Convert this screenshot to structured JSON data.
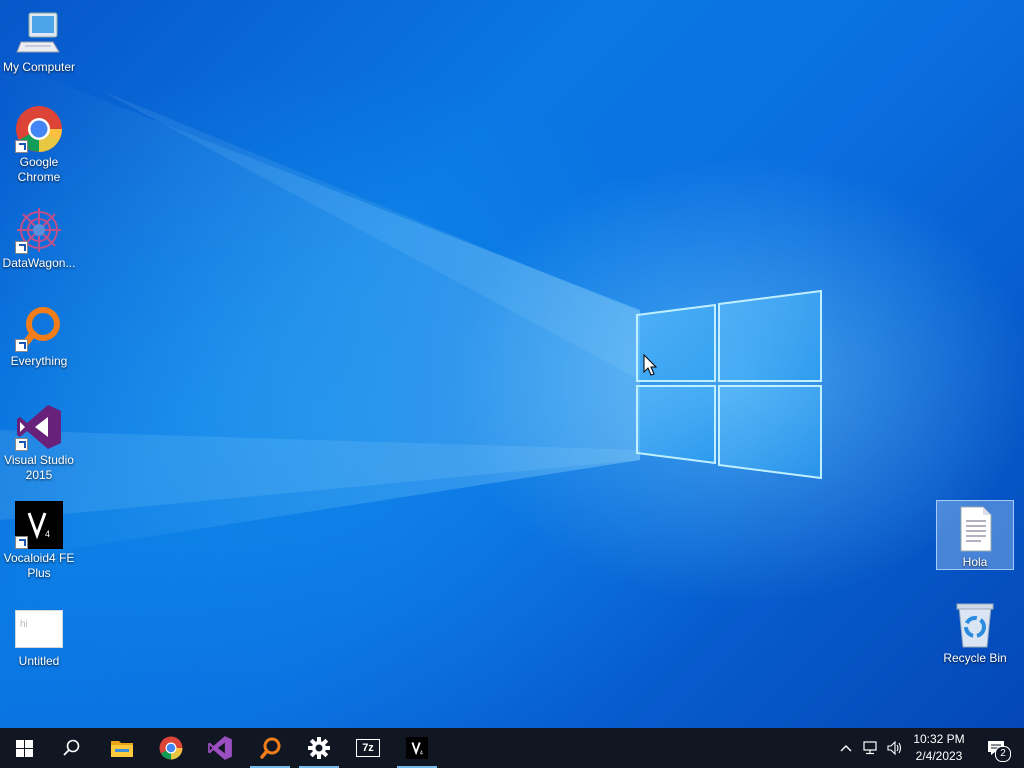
{
  "desktop": {
    "icons_left": [
      {
        "label": "My Computer",
        "icon": "computer-icon",
        "shortcut": false
      },
      {
        "label": "Google Chrome",
        "icon": "chrome-icon",
        "shortcut": true
      },
      {
        "label": "DataWagon...",
        "icon": "datawagon-icon",
        "shortcut": true
      },
      {
        "label": "Everything",
        "icon": "everything-icon",
        "shortcut": true
      },
      {
        "label": "Visual Studio 2015",
        "icon": "visual-studio-icon",
        "shortcut": true
      },
      {
        "label": "Vocaloid4 FE Plus",
        "icon": "vocaloid-icon",
        "shortcut": true
      },
      {
        "label": "Untitled",
        "icon": "image-file-icon",
        "shortcut": false,
        "thumb_text": "hi"
      }
    ],
    "icons_right": [
      {
        "label": "Hola",
        "icon": "text-document-icon",
        "selected": true
      },
      {
        "label": "Recycle Bin",
        "icon": "recycle-bin-icon",
        "selected": false
      }
    ]
  },
  "taskbar": {
    "items": [
      {
        "name": "start-button",
        "icon": "windows-logo-icon",
        "running": false
      },
      {
        "name": "search-button",
        "icon": "search-icon",
        "running": false
      },
      {
        "name": "file-explorer",
        "icon": "folder-icon",
        "running": false
      },
      {
        "name": "chrome",
        "icon": "chrome-icon",
        "running": false
      },
      {
        "name": "visual-studio",
        "icon": "visual-studio-icon",
        "running": false
      },
      {
        "name": "everything",
        "icon": "everything-icon",
        "running": true
      },
      {
        "name": "settings",
        "icon": "gear-icon",
        "running": true
      },
      {
        "name": "7zip",
        "icon": "7zip-icon",
        "running": false,
        "text": "7z"
      },
      {
        "name": "vocaloid",
        "icon": "vocaloid-icon",
        "running": true
      }
    ],
    "clock": {
      "time": "10:32 PM",
      "date": "2/4/2023"
    },
    "notifications": {
      "count": "2"
    }
  },
  "colors": {
    "taskbar": "#101723",
    "accent": "#76b9ed",
    "desktop": "#0a6fe0"
  }
}
